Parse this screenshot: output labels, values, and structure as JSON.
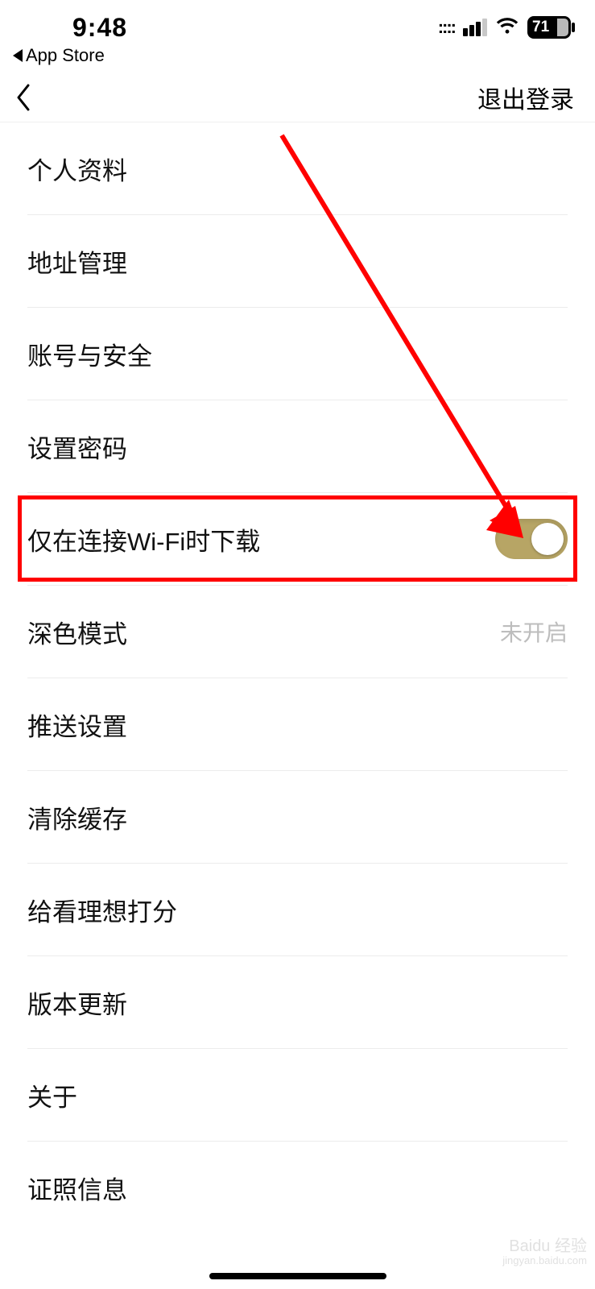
{
  "status": {
    "time": "9:48",
    "back_app_label": "App Store",
    "battery_pct": "71"
  },
  "nav": {
    "logout_label": "退出登录"
  },
  "rows": {
    "profile": "个人资料",
    "address": "地址管理",
    "account_security": "账号与安全",
    "set_password": "设置密码",
    "wifi_only_download": "仅在连接Wi-Fi时下载",
    "dark_mode": "深色模式",
    "dark_mode_value": "未开启",
    "push_settings": "推送设置",
    "clear_cache": "清除缓存",
    "clear_cache_value": " ",
    "rate_app": "给看理想打分",
    "version_update": "版本更新",
    "about": "关于",
    "license_info": "证照信息"
  },
  "watermark": {
    "brand": "Baidu 经验",
    "url": "jingyan.baidu.com"
  }
}
